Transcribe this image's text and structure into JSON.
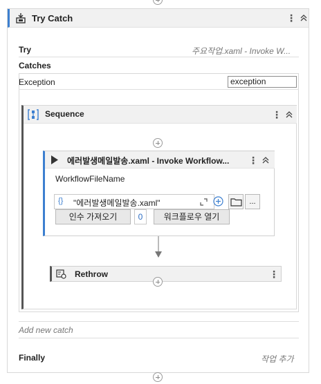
{
  "try_catch": {
    "title": "Try Catch",
    "try_label": "Try",
    "try_value": "주요작업.xaml - Invoke W...",
    "catches_label": "Catches",
    "exception_label": "Exception",
    "exception_variable": "exception",
    "add_catch_label": "Add new catch",
    "finally_label": "Finally",
    "finally_value": "작업 추가"
  },
  "sequence": {
    "title": "Sequence"
  },
  "invoke": {
    "title": "에러발생메일발송.xaml - Invoke Workflow...",
    "field_label": "WorkflowFileName",
    "expr_icon": "{}",
    "file_value": "\"에러발생메일발송.xaml\"",
    "browse_label": "...",
    "import_args_label": "인수 가져오기",
    "args_count": "0",
    "open_workflow_label": "워크플로우 열기"
  },
  "rethrow": {
    "title": "Rethrow"
  },
  "icons": [
    "try-catch-icon",
    "sequence-icon",
    "invoke-play-icon",
    "rethrow-icon",
    "expand-icon",
    "add-icon",
    "folder-icon",
    "kebab-menu-icon",
    "collapse-chevron-icon",
    "add-activity-icon"
  ],
  "colors": {
    "accent": "#3c7fd0",
    "header_bg": "#f1f1f1",
    "border": "#d8d8d8",
    "count_blue": "#2f6fc4"
  }
}
